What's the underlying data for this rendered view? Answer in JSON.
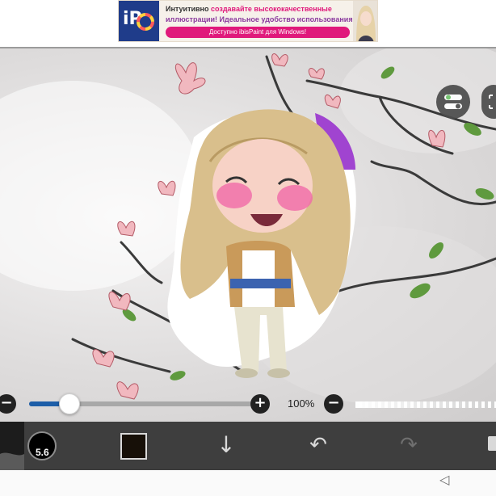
{
  "ad": {
    "logo_text": "iP",
    "line1_normal": "Интуитивно ",
    "line1_highlight": "создавайте высококачественные",
    "line2": "иллюстрации! Идеальное удобство использования!",
    "cta": "Доступно ibisPaint для Windows!"
  },
  "canvas": {
    "icons": [
      "layers-toggle-icon",
      "fullscreen-icon"
    ]
  },
  "brush_slider": {
    "minus_label": "−",
    "plus_label": "+",
    "value_fraction": 0.18
  },
  "opacity_slider": {
    "label": "100%",
    "minus_label": "−",
    "value_fraction": 1.0
  },
  "toolbar": {
    "brush_size_label": "5.6",
    "current_color": "#171008",
    "move_down_icon": "↓",
    "undo_icon": "↶",
    "redo_icon": "↷"
  },
  "system_nav": {
    "back_icon": "◁"
  },
  "colors": {
    "toolbar_bg": "#3e3e3e",
    "slider_accent": "#1d5ea8",
    "ad_brand": "#e0197b"
  }
}
